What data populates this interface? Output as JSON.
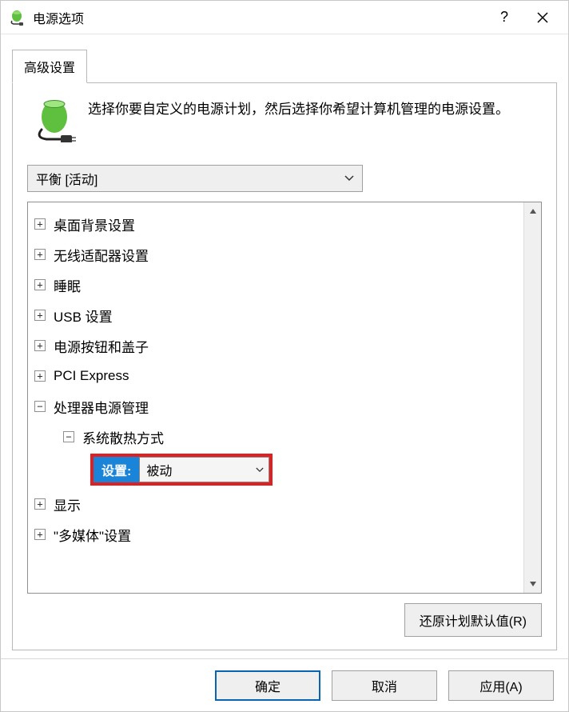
{
  "title": "电源选项",
  "tab_label": "高级设置",
  "description": "选择你要自定义的电源计划，然后选择你希望计算机管理的电源设置。",
  "plan_selected": "平衡 [活动]",
  "tree": {
    "items": [
      "桌面背景设置",
      "无线适配器设置",
      "睡眠",
      "USB 设置",
      "电源按钮和盖子",
      "PCI Express",
      "处理器电源管理",
      "显示",
      "\"多媒体\"设置"
    ],
    "child_label": "系统散热方式",
    "setting_label": "设置:",
    "setting_value": "被动"
  },
  "restore_defaults": "还原计划默认值(R)",
  "buttons": {
    "ok": "确定",
    "cancel": "取消",
    "apply": "应用(A)"
  }
}
